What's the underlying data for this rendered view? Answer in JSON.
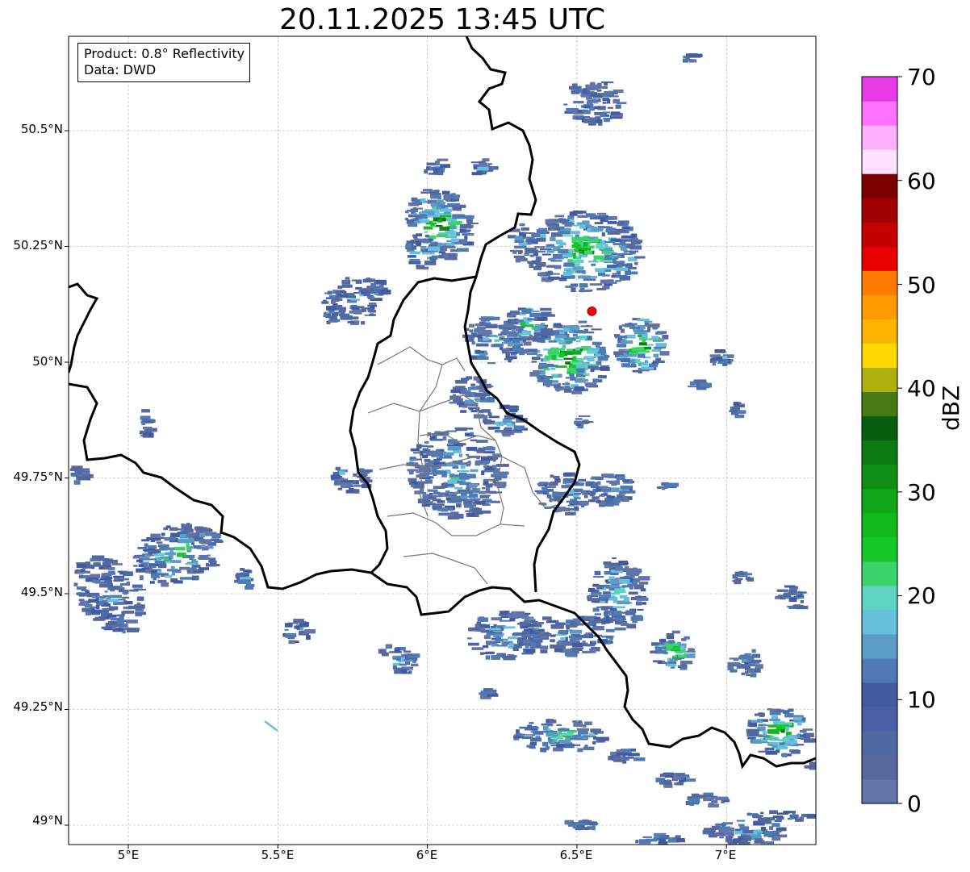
{
  "title": "20.11.2025 13:45 UTC",
  "info": {
    "product": "Product: 0.8° Reflectivity",
    "source": "Data: DWD"
  },
  "axes": {
    "lat_labels": [
      "50.5°N",
      "50.25°N",
      "50°N",
      "49.75°N",
      "49.5°N",
      "49.25°N",
      "49°N"
    ],
    "lon_labels": [
      "5°E",
      "5.5°E",
      "6°E",
      "6.5°E",
      "7°E"
    ]
  },
  "colorbar": {
    "label": "dBZ",
    "ticks": [
      "0",
      "10",
      "20",
      "30",
      "40",
      "50",
      "60",
      "70"
    ],
    "colors": [
      "#6374a8",
      "#57689f",
      "#4f6aa2",
      "#4a5fa6",
      "#425aa0",
      "#4f7ab3",
      "#5a9cc6",
      "#66bfdc",
      "#5ed4c0",
      "#3bd46a",
      "#14c82a",
      "#12b91c",
      "#10a618",
      "#0e8f14",
      "#0b7a10",
      "#085e0c",
      "#477a10",
      "#adb00c",
      "#ffd700",
      "#ffb400",
      "#ff9a00",
      "#ff7a00",
      "#e60000",
      "#c40000",
      "#a00000",
      "#7a0000",
      "#ffe0ff",
      "#ffb0ff",
      "#ff70ff",
      "#e83be8"
    ]
  },
  "marker": {
    "name": "radar site",
    "color": "#ff0000",
    "lat": 50.11,
    "lon": 6.55
  }
}
